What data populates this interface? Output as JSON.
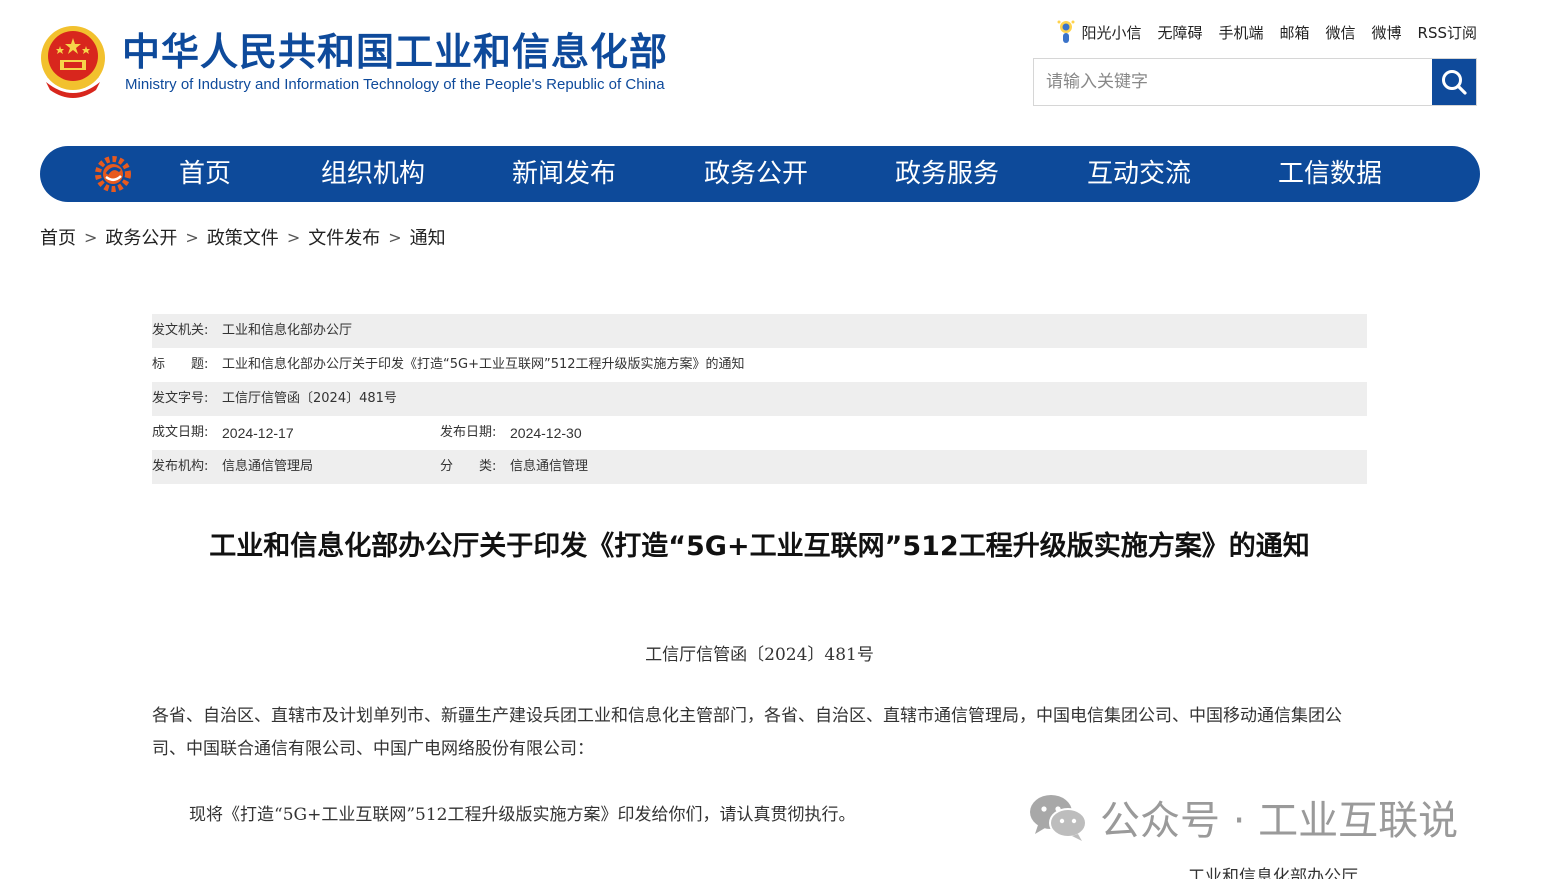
{
  "header": {
    "title": "中华人民共和国工业和信息化部",
    "subtitle": "Ministry of Industry and Information Technology of the People's Republic of China",
    "emblem_icon": "national-emblem-icon"
  },
  "top_links": {
    "items": [
      "阳光小信",
      "无障碍",
      "手机端",
      "邮箱",
      "微信",
      "微博",
      "RSS订阅"
    ]
  },
  "search": {
    "placeholder": "请输入关键字",
    "value": "",
    "icon": "search-icon"
  },
  "nav": {
    "items": [
      "首页",
      "组织机构",
      "新闻发布",
      "政务公开",
      "政务服务",
      "互动交流",
      "工信数据"
    ]
  },
  "breadcrumb": {
    "items": [
      "首页",
      "政务公开",
      "政策文件",
      "文件发布",
      "通知"
    ],
    "separator": ">"
  },
  "meta": {
    "issuer_label": "发文机关:",
    "issuer": "工业和信息化部办公厅",
    "title_label": "标　　题:",
    "title": "工业和信息化部办公厅关于印发《打造“5G+工业互联网”512工程升级版实施方案》的通知",
    "docno_label": "发文字号:",
    "docno": "工信厅信管函〔2024〕481号",
    "created_label": "成文日期:",
    "created": "2024-12-17",
    "published_label": "发布日期:",
    "published": "2024-12-30",
    "org_label": "发布机构:",
    "org": "信息通信管理局",
    "category_label": "分　　类:",
    "category": "信息通信管理"
  },
  "article": {
    "title": "工业和信息化部办公厅关于印发《打造“5G+工业互联网”512工程升级版实施方案》的通知",
    "doc_number": "工信厅信管函〔2024〕481号",
    "addressee": "各省、自治区、直辖市及计划单列市、新疆生产建设兵团工业和信息化主管部门，各省、自治区、直辖市通信管理局，中国电信集团公司、中国移动通信集团公司、中国联合通信有限公司、中国广电网络股份有限公司：",
    "body": "现将《打造“5G+工业互联网”512工程升级版实施方案》印发给你们，请认真贯彻执行。",
    "signature": "工业和信息化部办公厅"
  },
  "watermark": {
    "text": "公众号 · 工业互联说",
    "icon": "wechat-icon"
  },
  "colors": {
    "brand_blue": "#0d4a9a",
    "meta_shade": "#eeeeee"
  }
}
